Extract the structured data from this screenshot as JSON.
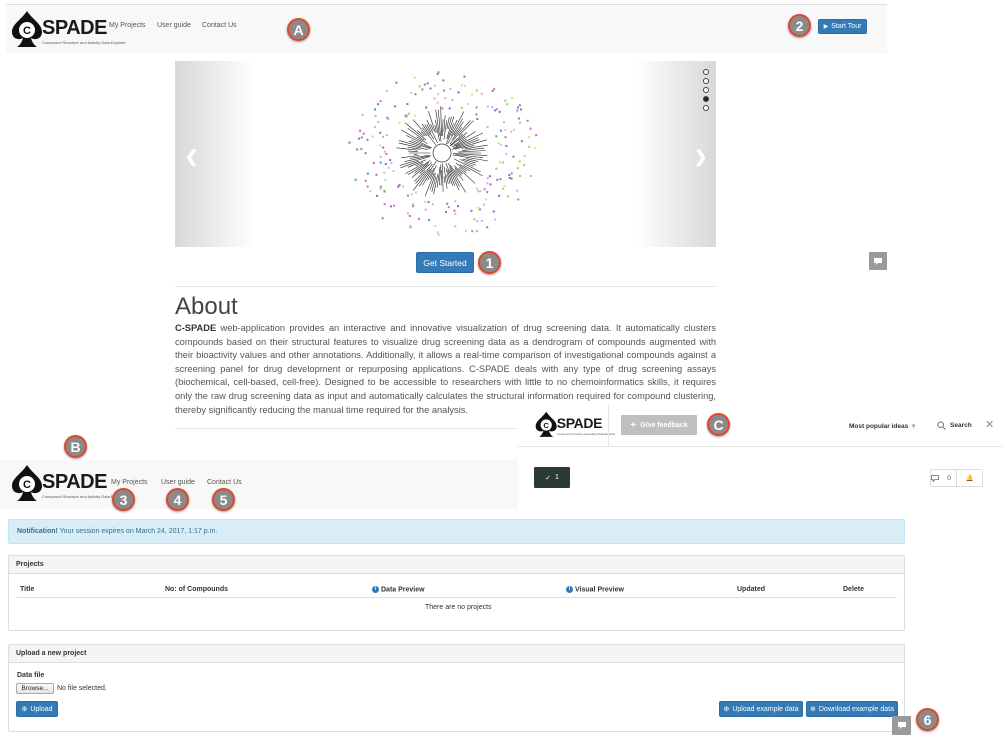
{
  "colors": {
    "primary": "#337ab7",
    "badge_bg": "#8a8a8a",
    "badge_border": "#e0472b",
    "notice_bg": "#d9edf7",
    "notice_text": "#31708f"
  },
  "logo": {
    "text": "SPADE",
    "letter": "C",
    "subtitle": "Compound Structure and Activity Data Explorer"
  },
  "top_nav": {
    "links": [
      "My Projects",
      "User guide",
      "Contact Us"
    ],
    "start_tour": "Start Tour"
  },
  "badges": {
    "a": "A",
    "b": "B",
    "c": "C",
    "n1": "1",
    "n2": "2",
    "n3": "3",
    "n4": "4",
    "n5": "5",
    "n6": "6"
  },
  "carousel": {
    "slides": 5,
    "active_slide": 4,
    "prev_icon": "chevron-left-icon",
    "next_icon": "chevron-right-icon"
  },
  "get_started": "Get Started",
  "about": {
    "title": "About",
    "brand": "C-SPADE",
    "text": " web-application provides an interactive and innovative visualization of drug screening data. It automatically clusters compounds based on their structural features to visualize drug screening data as a dendrogram of compounds augmented with their bioactivity values and other annotations. Additionally, it allows a real-time comparison of investigational compounds against a screening panel for drug development or repurposing applications. C-SPADE deals with any type of drug screening assays (biochemical, cell-based, cell-free). Designed to be accessible to researchers with little to no chemoinformatics skills, it requires only the raw drug screening data as input and automatically calculates the structural information required for compound clustering, thereby significantly reducing the manual time required for the analysis."
  },
  "feedback": {
    "give_feedback": "Give feedback",
    "sort": "Most popular ideas",
    "search": "Search",
    "vote_count": "1",
    "comment_count": "0"
  },
  "nav2": {
    "links": [
      "My Projects",
      "User guide",
      "Contact Us"
    ]
  },
  "notification": {
    "label": "Notification!",
    "text": " Your session expires on March 24, 2017, 1:17 p.m."
  },
  "projects": {
    "title": "Projects",
    "columns": [
      "Title",
      "No: of Compounds",
      "Data Preview",
      "Visual Preview",
      "Updated",
      "Delete"
    ],
    "empty": "There are no projects"
  },
  "upload": {
    "title": "Upload a new project",
    "data_file_label": "Data file",
    "browse": "Browse...",
    "no_file": "No file selected.",
    "upload_btn": "Upload",
    "upload_example": "Upload example data",
    "download_example": "Download example data"
  }
}
